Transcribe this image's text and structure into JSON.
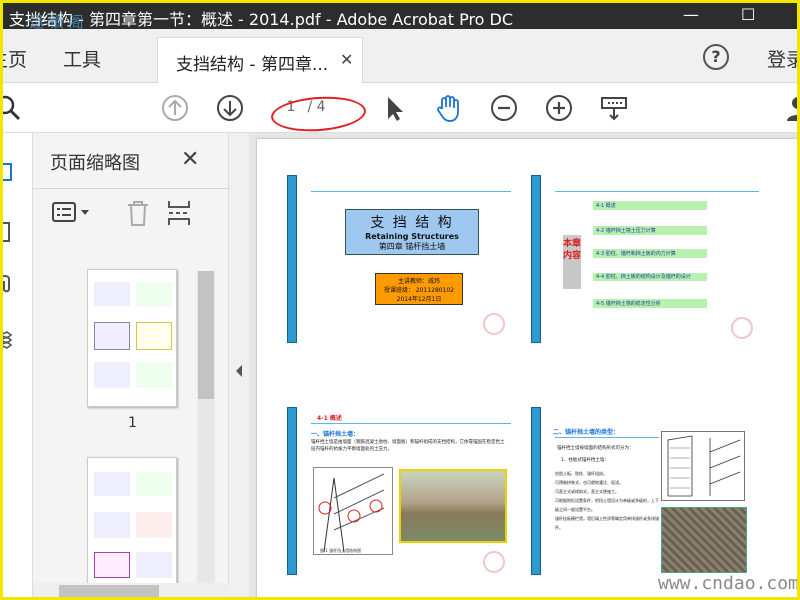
{
  "window": {
    "title": "支挡结构 - 第四章第一节：概述 - 2014.pdf - Adobe Acrobat Pro DC",
    "watermark_overlay": "迅 锁 阁",
    "minimize": "—",
    "maximize": "☐"
  },
  "tabs": {
    "home": "主页",
    "tools": "工具",
    "doc": "支挡结构 - 第四章...",
    "close": "✕",
    "help": "?",
    "login": "登录"
  },
  "toolbar": {
    "current_page": "1",
    "total_pages": "/ 4",
    "icons": [
      "search-icon",
      "page-up-icon",
      "page-down-icon",
      "select-arrow-icon",
      "hand-tool-icon",
      "zoom-out-icon",
      "zoom-in-icon",
      "marquee-zoom-icon",
      "account-icon"
    ]
  },
  "thumbnail_panel": {
    "title": "页面缩略图",
    "close": "✕",
    "page_labels": [
      "1"
    ]
  },
  "page1_slide1": {
    "title": "支 挡 结 构",
    "subtitle": "Retaining Structures",
    "chapter": "第四章 锚杆挡土墙",
    "lecturer": "主讲教师：戚炜",
    "contact": "授课班级：  2011280102",
    "date": "2014年12月1日"
  },
  "page1_slide2": {
    "side_label": "本章内容",
    "items": [
      "4-1  概述",
      "4-2  锚杆挡土墙土压力计算",
      "4-3  肋柱、锚杆和挡土板的内力计算",
      "4-4  肋柱、挡土板的结构设计及锚杆的设计",
      "4-5  锚杆挡土墙的稳定性分析"
    ]
  },
  "page1_slide3": {
    "section": "4-1   概述",
    "heading": "一、锚杆挡土墙：",
    "body": "锚杆挡土墙是由墙面（钢筋混凝土肋柱、墙面板）和锚杆组成的支挡结构，它依靠锚固在稳定岩土层内锚杆的抗拔力平衡墙面处的土压力。",
    "caption": "图 1  锚杆挡土墙结构图"
  },
  "page1_slide4": {
    "heading": "二、锚杆挡土墙的类型：",
    "intro": "锚杆挡土墙按墙面的结构形式可分为：",
    "sub": "1、柱板式锚杆挡土墙：",
    "bullets": [
      "由肋土板、肋柱、锚杆组成。",
      "可预制拼装式，也可就地灌注、现浇。",
      "可直立式或倾斜式，直立式便施工。",
      "可根据地形设置条件，把挡土墙设计为单级或多级的，上下级之间一般设置平台。",
      "锚杆挂板栅栏墙，墙后填土性质等确定用单排锚杆或多排锚杆。"
    ]
  },
  "site_watermark": "www.cndao.com"
}
